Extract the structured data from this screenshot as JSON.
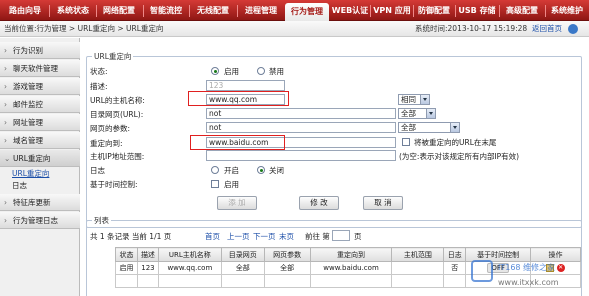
{
  "nav": {
    "items": [
      "路由向导",
      "系统状态",
      "网络配置",
      "智能流控",
      "无线配置",
      "进程管理",
      "行为管理",
      "WEB认证",
      "VPN 应用",
      "防御配置",
      "USB 存储",
      "高级配置",
      "系统维护"
    ],
    "active_index": 6
  },
  "infobar": {
    "location": "当前位置:行为管理 > URL重定向 > URL重定向",
    "system_time": "系统时间:2013-10-17 15:19:28",
    "home_link": "返回首页",
    "help": "帮助"
  },
  "sidebar": {
    "items": [
      {
        "label": "行为识别"
      },
      {
        "label": "聊天软件管理"
      },
      {
        "label": "游戏管理"
      },
      {
        "label": "邮件监控"
      },
      {
        "label": "网址管理"
      },
      {
        "label": "域名管理"
      },
      {
        "label": "URL重定向"
      },
      {
        "label": "特征库更新"
      },
      {
        "label": "行为管理日志"
      }
    ],
    "sub": [
      "URL重定向",
      "日志"
    ]
  },
  "form": {
    "legend": "URL重定向",
    "status_label": "状态:",
    "status_on": "启用",
    "status_off": "禁用",
    "desc_label": "描述:",
    "desc_placeholder": "123",
    "host_label": "URL的主机名称:",
    "host_value": "www.qq.com",
    "host_mode": "相同",
    "dir_label": "目录网页(URL):",
    "dir_value": "not",
    "dir_mode": "全部",
    "param_label": "网页的参数:",
    "param_value": "not",
    "param_mode": "全部",
    "redirect_label": "重定向到:",
    "redirect_value": "www.baidu.com",
    "append_url_label": "将被重定向的URL在末尾",
    "ip_label": "主机IP地址范围:",
    "ip_hint": "(为空:表示对该规定所有内部IP有效)",
    "log_label": "日志",
    "log_on": "开启",
    "log_off": "关闭",
    "time_label": "基于时间控制:",
    "time_enable": "启用",
    "btn_add": "添 加",
    "btn_modify": "修 改",
    "btn_cancel": "取 消"
  },
  "list": {
    "legend": "列表",
    "summary": "共 1 条记录 当前 1/1 页",
    "first": "首页",
    "prev": "上一页",
    "next": "下一页",
    "last": "末页",
    "goto_label": "前往 第",
    "goto_suffix": "页",
    "columns": [
      "状态",
      "描述",
      "URL主机名称",
      "目录网页",
      "网页参数",
      "重定向到",
      "主机范围",
      "日志",
      "基于时间控制",
      "操作"
    ],
    "rows": [
      [
        "启用",
        "123",
        "www.qq.com",
        "全部",
        "全部",
        "www.baidu.com",
        "",
        "否",
        "OFF",
        ""
      ]
    ]
  },
  "watermark": {
    "brand": "IT168 维修之家",
    "site": "www.itxxk.com"
  },
  "colors": {
    "nav_red": "#b9201c",
    "link_blue": "#1b4ea8",
    "highlight_red": "#e02020"
  }
}
